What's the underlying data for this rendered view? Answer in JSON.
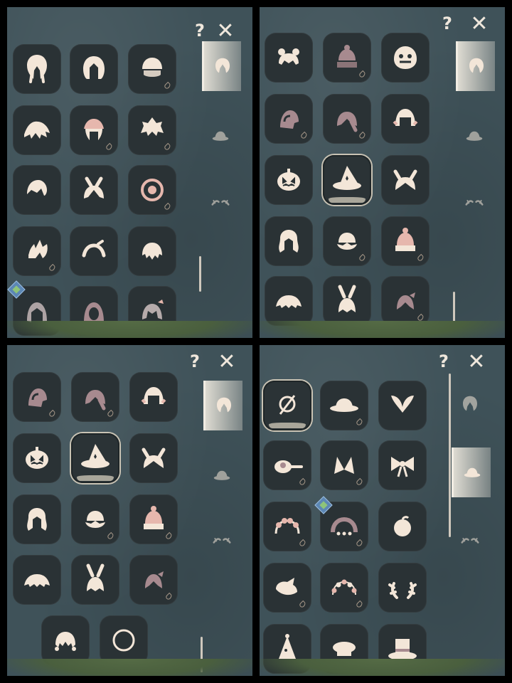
{
  "toolbar": {
    "help_label": "?",
    "close_label": "✕"
  },
  "colors": {
    "panel_bg": "#3f5259",
    "tile_bg": "#2a3235",
    "icon": "#f3e6d8",
    "accent": "#c9c3b4"
  },
  "panels": [
    {
      "name": "hair-panel-top-left",
      "active_tab": "hair",
      "items": [
        "braided-hair-icon",
        "bob-hair-icon",
        "capped-hair-icon",
        "messy-hair-icon",
        "bandana-hair-icon",
        "spiky-hair-icon",
        "swoop-hair-icon",
        "bunny-ears-hair-icon",
        "flower-pin-hair-icon",
        "flame-hair-icon",
        "headband-hair-icon",
        "short-waves-hair-icon",
        "hood-hair-icon",
        "cloak-hood-icon",
        "ribbon-ponytail-icon"
      ]
    },
    {
      "name": "hair-panel-top-right",
      "active_tab": "hair",
      "items": [
        "bun-hair-icon",
        "beanie-hair-icon",
        "lion-mask-icon",
        "hooded-helm-icon",
        "ponytail-hair-icon",
        "bob-bangs-icon",
        "pumpkin-head-icon",
        "witch-hat-icon",
        "cat-ears-hair-icon",
        "long-wavy-hair-icon",
        "beret-hair-icon",
        "knit-beanie-icon",
        "fluffy-hair-icon",
        "bunny-hood-icon",
        "side-ponytail-icon"
      ]
    },
    {
      "name": "hair-panel-bottom-left",
      "active_tab": "hair",
      "items": [
        "hooded-helm-icon",
        "ponytail-hair-icon",
        "bob-bangs-icon",
        "pumpkin-head-icon",
        "witch-hat-icon",
        "cat-ears-hair-icon",
        "long-wavy-hair-icon",
        "beret-hair-icon",
        "knit-beanie-icon",
        "fluffy-hair-icon",
        "bunny-hood-icon",
        "side-ponytail-icon",
        "curly-hair-icon",
        "halo-ring-icon"
      ]
    },
    {
      "name": "hat-panel-bottom-right",
      "active_tab": "hat",
      "items": [
        "none-icon",
        "sun-hat-icon",
        "butterfly-icon",
        "pan-icon",
        "fox-ears-icon",
        "bow-icon",
        "flower-crown-icon",
        "bead-crown-icon",
        "peach-icon",
        "bird-icon",
        "blossom-crown-icon",
        "antlers-icon",
        "party-hat-icon",
        "beret-icon",
        "top-hat-icon"
      ]
    }
  ]
}
